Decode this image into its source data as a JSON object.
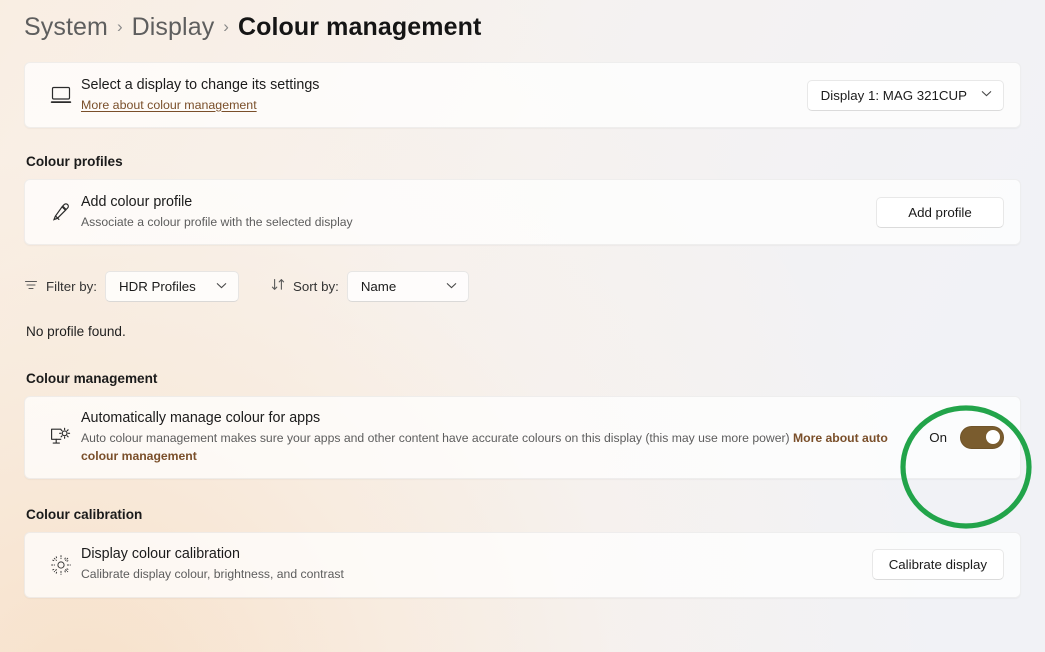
{
  "breadcrumb": {
    "items": [
      "System",
      "Display",
      "Colour management"
    ],
    "separator": "›"
  },
  "display_card": {
    "icon": "monitor-icon",
    "title": "Select a display to change its settings",
    "link": "More about colour management",
    "selector_value": "Display 1: MAG 321CUP",
    "chevron": "⌄"
  },
  "colour_profiles": {
    "heading": "Colour profiles",
    "icon": "eyedropper-icon",
    "title": "Add colour profile",
    "subtitle": "Associate a colour profile with the selected display",
    "button": "Add profile"
  },
  "filter_row": {
    "filter_icon": "filter-icon",
    "filter_label": "Filter by:",
    "filter_value": "HDR Profiles",
    "sort_icon": "sort-icon",
    "sort_label": "Sort by:",
    "sort_value": "Name",
    "empty_message": "No profile found."
  },
  "colour_management": {
    "heading": "Colour management",
    "icon": "monitor-brightness-icon",
    "title": "Automatically manage colour for apps",
    "subtitle": "Auto colour management makes sure your apps and other content have accurate colours on this display (this may use more power)",
    "subtitle_link": "More about auto colour management",
    "toggle_state": "On",
    "toggle_on": true
  },
  "colour_calibration": {
    "heading": "Colour calibration",
    "icon": "brightness-sunburst-icon",
    "title": "Display colour calibration",
    "subtitle": "Calibrate display colour, brightness, and contrast",
    "button": "Calibrate display"
  },
  "annotation": {
    "shape": "ellipse-highlight",
    "colour": "#22a44a",
    "target": "auto-colour-management-toggle"
  },
  "colours": {
    "accent_link": "#7a4f2a",
    "toggle_on_fill": "#7a5c2e",
    "annotation_green": "#22a44a",
    "page_background": "#f3f3f5"
  }
}
